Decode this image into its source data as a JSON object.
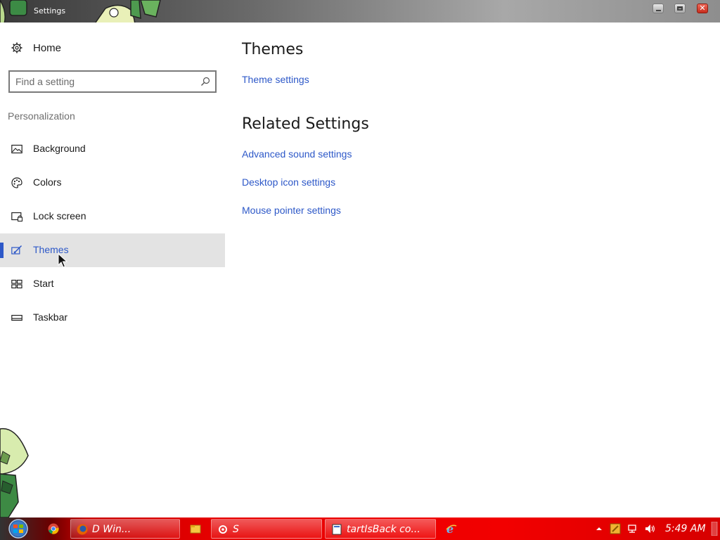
{
  "window": {
    "title": "Settings",
    "minimize_icon": "minimize-icon",
    "maximize_icon": "maximize-icon",
    "close_icon": "close-icon"
  },
  "sidebar": {
    "home_label": "Home",
    "search_placeholder": "Find a setting",
    "section": "Personalization",
    "items": [
      {
        "label": "Background",
        "icon": "picture-icon",
        "selected": false
      },
      {
        "label": "Colors",
        "icon": "palette-icon",
        "selected": false
      },
      {
        "label": "Lock screen",
        "icon": "lock-screen-icon",
        "selected": false
      },
      {
        "label": "Themes",
        "icon": "themes-brush-icon",
        "selected": true
      },
      {
        "label": "Start",
        "icon": "start-tiles-icon",
        "selected": false
      },
      {
        "label": "Taskbar",
        "icon": "taskbar-icon",
        "selected": false
      }
    ]
  },
  "main": {
    "heading": "Themes",
    "theme_settings_link": "Theme settings",
    "related_heading": "Related Settings",
    "related_links": [
      "Advanced sound settings",
      "Desktop icon settings",
      "Mouse pointer settings"
    ]
  },
  "taskbar": {
    "apps": [
      {
        "label": "D        Win...",
        "icon": "firefox-icon"
      },
      {
        "label": "S",
        "icon": "settings-gear-icon"
      },
      {
        "label": "tartIsBack co...",
        "icon": "window-app-icon"
      }
    ],
    "clock": "5:49 AM"
  },
  "colors": {
    "accent": "#2d58c8",
    "selected_bg": "#e3e3e3",
    "taskbar": "#e60000"
  }
}
